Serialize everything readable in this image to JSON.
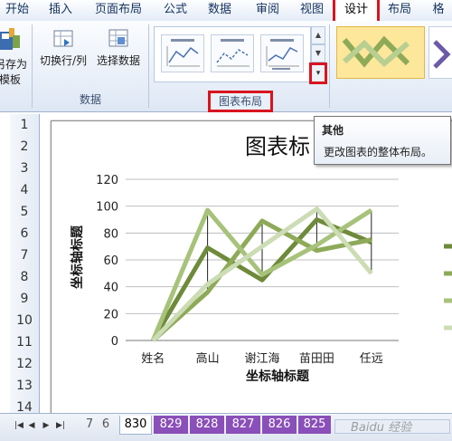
{
  "ribbon_tabs": [
    "开始",
    "插入",
    "页面布局",
    "公式",
    "数据",
    "审阅",
    "视图",
    "设计",
    "布局",
    "格"
  ],
  "active_tab": "设计",
  "ribbon": {
    "save_template_label_1": "另存为",
    "save_template_label_2": "模板",
    "switch_row_col_label": "切换行/列",
    "select_data_label": "选择数据",
    "data_group_label": "数据",
    "layout_group_label": "图表布局"
  },
  "tooltip": {
    "title": "其他",
    "description": "更改图表的整体布局。"
  },
  "rows": [
    "1",
    "2",
    "3",
    "4",
    "5",
    "6",
    "7",
    "8",
    "9",
    "10",
    "11",
    "12",
    "13",
    "14"
  ],
  "sheet_tabs": [
    "7",
    "6",
    "830",
    "829",
    "828",
    "827",
    "826",
    "825"
  ],
  "active_sheet": "830",
  "watermark": "Baidu 经验",
  "colors": {
    "accent_red": "#d9141f",
    "series_dark": "#6e8a3a",
    "series_mid": "#8eaa58",
    "series_light": "#b8cf92",
    "series_pale": "#ccdcb5"
  },
  "chart_data": {
    "type": "line",
    "title": "图表标",
    "xlabel": "坐标轴标题",
    "ylabel": "坐标轴标题",
    "categories": [
      "姓名",
      "高山",
      "谢江海",
      "苗田田",
      "任远"
    ],
    "ylim": [
      0,
      120
    ],
    "yticks": [
      0,
      20,
      40,
      60,
      80,
      100,
      120
    ],
    "grid": true,
    "series": [
      {
        "values": [
          0,
          69,
          45,
          90,
          73
        ],
        "color": "#6e8a3a"
      },
      {
        "values": [
          0,
          36,
          89,
          67,
          75
        ],
        "color": "#8eaa58"
      },
      {
        "values": [
          0,
          97,
          49,
          71,
          97
        ],
        "color": "#a7c27a"
      },
      {
        "values": [
          0,
          42,
          70,
          98,
          50
        ],
        "color": "#ccdcb5"
      }
    ]
  }
}
